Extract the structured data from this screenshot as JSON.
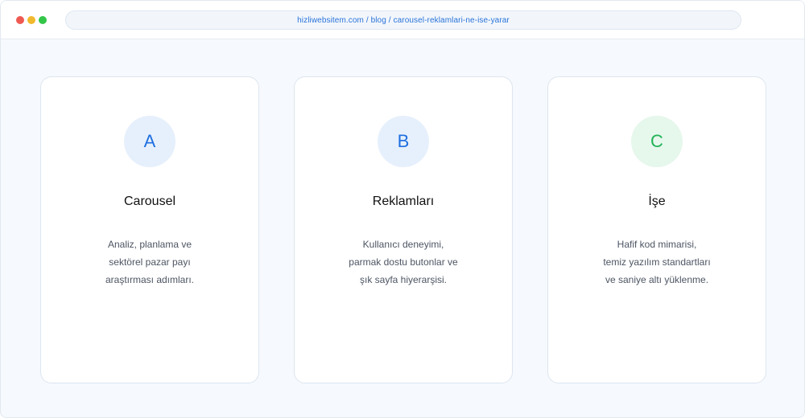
{
  "browser": {
    "url": "hizliwebsitem.com / blog / carousel-reklamlari-ne-ise-yarar"
  },
  "cards": [
    {
      "badge": "A",
      "title": "Carousel",
      "lines": [
        "Analiz, planlama ve",
        "sektörel pazar payı",
        "araştırması adımları."
      ]
    },
    {
      "badge": "B",
      "title": "Reklamları",
      "lines": [
        "Kullanıcı deneyimi,",
        "parmak dostu butonlar ve",
        "şık sayfa hiyerarşisi."
      ]
    },
    {
      "badge": "C",
      "title": "İşe",
      "lines": [
        "Hafif kod mimarisi,",
        "temiz yazılım standartları",
        "ve saniye altı yüklenme."
      ]
    }
  ],
  "colors": {
    "accent_blue": "#1f6fe0",
    "accent_green": "#22b357",
    "badge_blue_bg": "#e6f0fc",
    "badge_green_bg": "#e6f7ec"
  }
}
